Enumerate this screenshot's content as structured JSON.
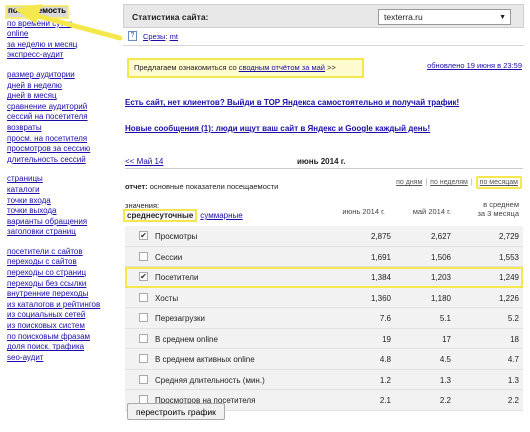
{
  "sidebar": {
    "groups": [
      [
        "посещаемость",
        "по времени суток",
        "online",
        "за неделю и месяц",
        "экспресс-аудит"
      ],
      [
        "размер аудитории",
        "дней в неделю",
        "дней в месяц",
        "сравнение аудиторий",
        "сессий на посетителя",
        "возвраты",
        "просм. на посетителя",
        "просмотров за сессию",
        "длительность сессий"
      ],
      [
        "страницы",
        "каталоги",
        "точки входа",
        "точки выхода",
        "варианты обращения",
        "заголовки страниц"
      ],
      [
        "посетители с сайтов",
        "переходы с сайтов",
        "переходы со страниц",
        "переходы без ссылки",
        "внутренние переходы",
        "из каталогов и рейтингов",
        "из социальных сетей",
        "из поисковых систем",
        "по поисковым фразам",
        "доля поиск. трафика",
        "seo-аудит"
      ]
    ]
  },
  "header": {
    "title": "Статистика сайта:",
    "site": "texterra.ru"
  },
  "subbar": {
    "help": "?",
    "slices_label": "Срезы",
    "slices_sep": ":",
    "slices_value": "mt"
  },
  "notice": {
    "prefix": "Предлагаем ознакомиться со ",
    "link": "сводным отчётом за май",
    "suffix": " >>"
  },
  "updated": "обновлено 19 июня в 23:59",
  "promos": [
    "Есть сайт, нет клиентов? Выйди в TOP Яндекса самостоятельно и получай трафик!",
    "Новые сообщения (1): люди ищут ваш сайт в Яндекс и Google каждый день!"
  ],
  "monthnav": {
    "prev": "<< Май 14",
    "current": "июнь 2014 г."
  },
  "report": {
    "label": "отчет:",
    "text": " основные показатели посещаемости"
  },
  "periods": [
    "по дням",
    "по неделям",
    "по месяцам"
  ],
  "values_label": "значения:",
  "modes": {
    "active": "среднесуточные",
    "other": "суммарные"
  },
  "columns": [
    "июнь 2014 г.",
    "май 2014 г.",
    "в среднем",
    "за 3 месяца"
  ],
  "rows": [
    {
      "label": "Просмотры",
      "checked": true,
      "v": [
        "2,875",
        "2,627",
        "2,729"
      ]
    },
    {
      "label": "Сессии",
      "checked": false,
      "v": [
        "1,691",
        "1,506",
        "1,553"
      ]
    },
    {
      "label": "Посетители",
      "checked": true,
      "v": [
        "1,384",
        "1,203",
        "1,249"
      ],
      "highlight": true
    },
    {
      "label": "Хосты",
      "checked": false,
      "v": [
        "1,360",
        "1,180",
        "1,226"
      ]
    },
    {
      "label": "Перезагрузки",
      "checked": false,
      "v": [
        "7.6",
        "5.1",
        "5.2"
      ]
    },
    {
      "label": "В среднем online",
      "checked": false,
      "v": [
        "19",
        "17",
        "18"
      ]
    },
    {
      "label": "В среднем активных online",
      "checked": false,
      "v": [
        "4.8",
        "4.5",
        "4.7"
      ]
    },
    {
      "label": "Средняя длительность (мин.)",
      "checked": false,
      "v": [
        "1.2",
        "1.3",
        "1.3"
      ]
    },
    {
      "label": "Просмотров на посетителя",
      "checked": false,
      "v": [
        "2.1",
        "2.2",
        "2.2"
      ]
    }
  ],
  "check_mark": "✔",
  "rebuild_button": "перестроить график",
  "colors": {
    "highlight": "#f4e84c",
    "link": "#1a0dab",
    "row_bg": "#f2f2f2"
  }
}
